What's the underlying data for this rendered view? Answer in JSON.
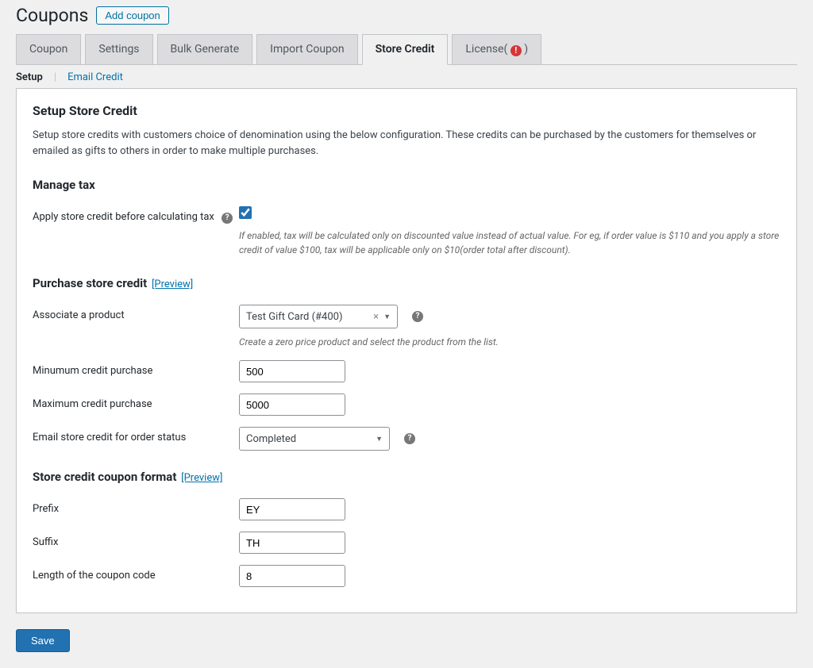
{
  "page": {
    "title": "Coupons",
    "add_button": "Add coupon"
  },
  "tabs": {
    "items": [
      {
        "label": "Coupon",
        "active": false
      },
      {
        "label": "Settings",
        "active": false
      },
      {
        "label": "Bulk Generate",
        "active": false
      },
      {
        "label": "Import Coupon",
        "active": false
      },
      {
        "label": "Store Credit",
        "active": true
      },
      {
        "label_pre": "License( ",
        "label_post": " )",
        "alert": "!",
        "active": false
      }
    ]
  },
  "subtabs": {
    "setup": "Setup",
    "email_credit": "Email Credit"
  },
  "sections": {
    "setup_title": "Setup Store Credit",
    "setup_desc": "Setup store credits with customers choice of denomination using the below configuration. These credits can be purchased by the customers for themselves or emailed as gifts to others in order to make multiple purchases.",
    "manage_tax": "Manage tax",
    "manage_tax_row": {
      "label": "Apply store credit before calculating tax",
      "checked": true,
      "hint": "If enabled, tax will be calculated only on discounted value instead of actual value. For eg, if order value is $110 and you apply a store credit of value $100, tax will be applicable only on $10(order total after discount)."
    },
    "purchase_title": "Purchase store credit",
    "preview": "[Preview]",
    "associate": {
      "label": "Associate a product",
      "value": "Test Gift Card (#400)",
      "hint": "Create a zero price product and select the product from the list."
    },
    "min": {
      "label": "Minumum credit purchase",
      "value": "500"
    },
    "max": {
      "label": "Maximum credit purchase",
      "value": "5000"
    },
    "email_status": {
      "label": "Email store credit for order status",
      "value": "Completed"
    },
    "format_title": "Store credit coupon format",
    "prefix": {
      "label": "Prefix",
      "value": "EY"
    },
    "suffix": {
      "label": "Suffix",
      "value": "TH"
    },
    "length": {
      "label": "Length of the coupon code",
      "value": "8"
    }
  },
  "actions": {
    "save": "Save"
  }
}
